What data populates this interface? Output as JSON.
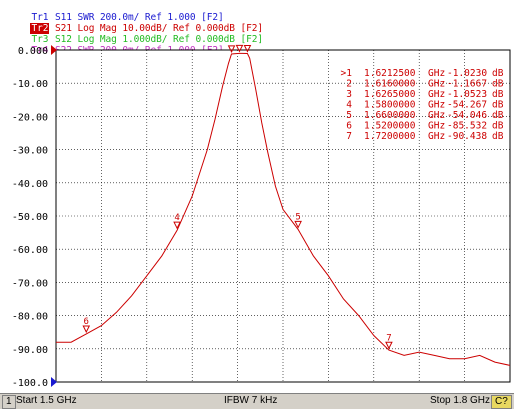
{
  "traces": [
    {
      "label": "Tr1",
      "param": "S11",
      "format": "SWR",
      "scale": "200.0m/",
      "ref": "Ref 1.000",
      "tag": "[F2]",
      "color": "#1a1ad0",
      "active": false
    },
    {
      "label": "Tr2",
      "param": "S21",
      "format": "Log Mag",
      "scale": "10.00dB/",
      "ref": "Ref 0.000dB",
      "tag": "[F2]",
      "color": "#cc0000",
      "active": true
    },
    {
      "label": "Tr3",
      "param": "S12",
      "format": "Log Mag",
      "scale": "1.000dB/",
      "ref": "Ref 0.000dB",
      "tag": "[F2]",
      "color": "#22bb22",
      "active": false
    },
    {
      "label": "Tr4",
      "param": "S22",
      "format": "SWR",
      "scale": "200.0m/",
      "ref": "Ref 1.000",
      "tag": "[F2]",
      "color": "#c030c0",
      "active": false
    }
  ],
  "chart_data": {
    "type": "line",
    "xlabel": "",
    "ylabel": "",
    "xlim": [
      1.5,
      1.8
    ],
    "x_unit": "GHz",
    "ylim": [
      -100,
      0
    ],
    "y_ticks": [
      0,
      -10,
      -20,
      -30,
      -40,
      -50,
      -60,
      -70,
      -80,
      -90,
      -100
    ],
    "y_tick_labels": [
      "0.000",
      "-10.00",
      "-20.00",
      "-30.00",
      "-40.00",
      "-50.00",
      "-60.00",
      "-70.00",
      "-80.00",
      "-90.00",
      "-100.0"
    ],
    "grid": true,
    "series": [
      {
        "name": "S21",
        "color": "#cc0000",
        "x": [
          1.5,
          1.51,
          1.52,
          1.53,
          1.54,
          1.55,
          1.56,
          1.57,
          1.58,
          1.59,
          1.6,
          1.605,
          1.61,
          1.614,
          1.616,
          1.62,
          1.6212,
          1.623,
          1.6265,
          1.628,
          1.632,
          1.636,
          1.64,
          1.645,
          1.65,
          1.66,
          1.67,
          1.68,
          1.69,
          1.7,
          1.71,
          1.72,
          1.73,
          1.74,
          1.75,
          1.76,
          1.77,
          1.78,
          1.79,
          1.8
        ],
        "y": [
          -88,
          -88,
          -85.5,
          -83,
          -79,
          -74,
          -68,
          -62,
          -54.3,
          -44,
          -30,
          -21,
          -11,
          -4,
          -1.2,
          -1.05,
          -1.02,
          -1.03,
          -1.05,
          -2.5,
          -12,
          -22,
          -31,
          -41,
          -48,
          -54.05,
          -62,
          -68,
          -75,
          -80,
          -86,
          -90.4,
          -92,
          -91,
          -92,
          -93,
          -93,
          -92,
          -94,
          -95
        ]
      }
    ]
  },
  "markers": {
    "table": [
      {
        "id": ">1",
        "freq": "1.6212500",
        "unit": "GHz",
        "value": "-1.0230",
        "vunit": "dB"
      },
      {
        "id": "2",
        "freq": "1.6160000",
        "unit": "GHz",
        "value": "-1.1667",
        "vunit": "dB"
      },
      {
        "id": "3",
        "freq": "1.6265000",
        "unit": "GHz",
        "value": "-1.0523",
        "vunit": "dB"
      },
      {
        "id": "4",
        "freq": "1.5800000",
        "unit": "GHz",
        "value": "-54.267",
        "vunit": "dB"
      },
      {
        "id": "5",
        "freq": "1.6600000",
        "unit": "GHz",
        "value": "-54.046",
        "vunit": "dB"
      },
      {
        "id": "6",
        "freq": "1.5200000",
        "unit": "GHz",
        "value": "-85.532",
        "vunit": "dB"
      },
      {
        "id": "7",
        "freq": "1.7200000",
        "unit": "GHz",
        "value": "-90.438",
        "vunit": "dB"
      }
    ],
    "points": [
      {
        "n": "1",
        "x": 1.62125,
        "y": -1.023
      },
      {
        "n": "2",
        "x": 1.616,
        "y": -1.1667
      },
      {
        "n": "3",
        "x": 1.6265,
        "y": -1.0523
      },
      {
        "n": "4",
        "x": 1.58,
        "y": -54.267
      },
      {
        "n": "5",
        "x": 1.66,
        "y": -54.046
      },
      {
        "n": "6",
        "x": 1.52,
        "y": -85.532
      },
      {
        "n": "7",
        "x": 1.72,
        "y": -90.438
      }
    ]
  },
  "status": {
    "channel": "1",
    "start": "Start 1.5 GHz",
    "ifbw": "IFBW 7 kHz",
    "stop": "Stop 1.8 GHz",
    "cal": "C?"
  }
}
